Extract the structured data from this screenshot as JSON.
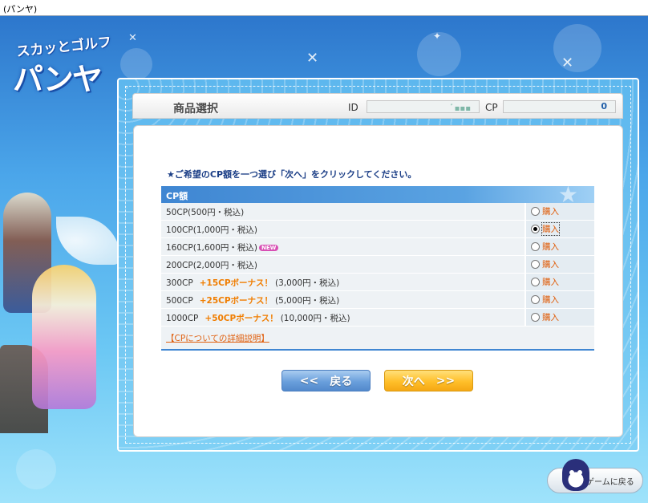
{
  "window": {
    "title": "(パンヤ)"
  },
  "logo": {
    "line1": "スカッとゴルフ",
    "line2": "パンヤ"
  },
  "header": {
    "section_title": "商品選択",
    "id_label": "ID",
    "id_value": "ﾞ▪▪▪",
    "cp_label": "CP",
    "cp_value": "0"
  },
  "instruction": {
    "star": "★",
    "text": "ご希望のCP額を一つ選び「次へ」をクリックしてください。"
  },
  "table": {
    "header": "CP額",
    "buy_label": "購入",
    "rows": [
      {
        "name": "50CP",
        "bonus": "",
        "price": "(500円・税込)",
        "new": "",
        "selected": false
      },
      {
        "name": "100CP",
        "bonus": "",
        "price": "(1,000円・税込)",
        "new": "",
        "selected": true
      },
      {
        "name": "160CP",
        "bonus": "",
        "price": "(1,600円・税込)",
        "new": "NEW",
        "selected": false
      },
      {
        "name": "200CP",
        "bonus": "",
        "price": "(2,000円・税込)",
        "new": "",
        "selected": false
      },
      {
        "name": "300CP",
        "bonus": "+15CPボーナス！",
        "price": "(3,000円・税込)",
        "new": "",
        "selected": false
      },
      {
        "name": "500CP",
        "bonus": "+25CPボーナス！",
        "price": "(5,000円・税込)",
        "new": "",
        "selected": false
      },
      {
        "name": "1000CP",
        "bonus": "+50CPボーナス！",
        "price": "(10,000円・税込)",
        "new": "",
        "selected": false
      }
    ],
    "detail_link": "【CPについての詳細説明】"
  },
  "buttons": {
    "back_arrow": "<<",
    "back_label": "戻る",
    "next_label": "次へ",
    "next_arrow": ">>",
    "return_game": "ゲームに戻る"
  }
}
